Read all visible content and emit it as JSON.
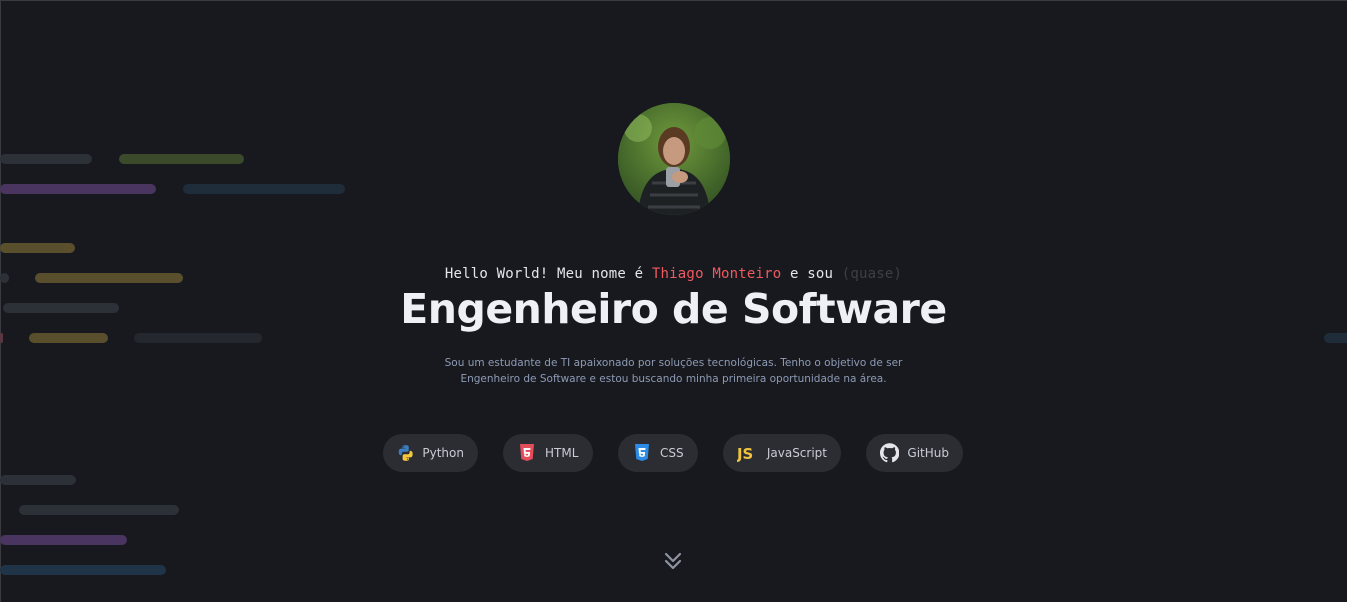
{
  "hero": {
    "greeting_prefix": "Hello World! Meu nome é ",
    "name": "Thiago Monteiro",
    "greeting_middle": " e sou ",
    "greeting_muted": "(quase)",
    "title": "Engenheiro de Software",
    "description_line1": "Sou um estudante de TI apaixonado por soluções tecnológicas. Tenho o objetivo de ser",
    "description_line2": "Engenheiro de Software e estou buscando minha primeira oportunidade na área."
  },
  "skills": [
    {
      "label": "Python",
      "icon": "python-icon"
    },
    {
      "label": "HTML",
      "icon": "html5-icon"
    },
    {
      "label": "CSS",
      "icon": "css3-icon"
    },
    {
      "label": "JavaScript",
      "icon": "js-icon"
    },
    {
      "label": "GitHub",
      "icon": "github-icon"
    }
  ],
  "colors": {
    "background": "#18191e",
    "accent_name": "#ef5a5f",
    "pill_bg": "#2c2d33",
    "description": "#8d9bb5"
  }
}
